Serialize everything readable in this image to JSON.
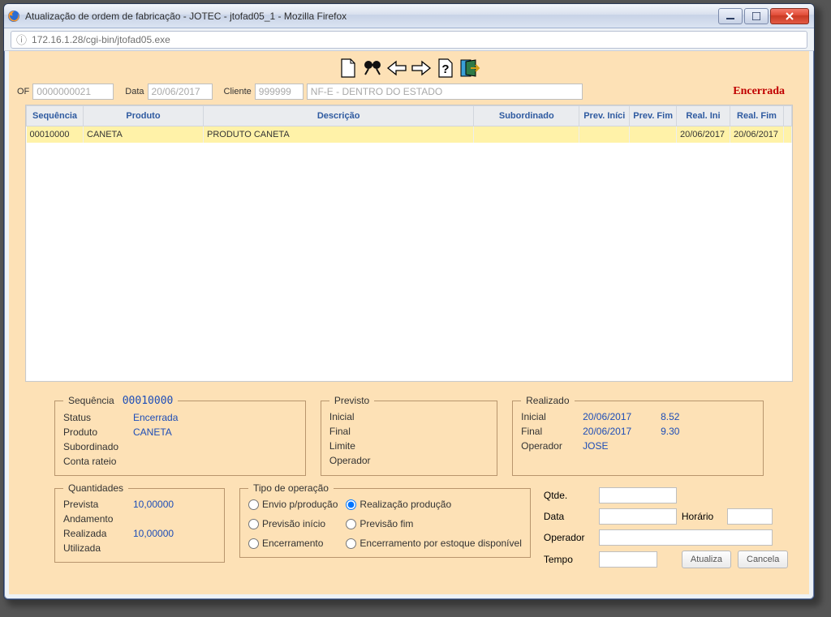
{
  "window": {
    "title": "Atualização de ordem de fabricação - JOTEC - jtofad05_1 - Mozilla Firefox",
    "url": "172.16.1.28/cgi-bin/jtofad05.exe"
  },
  "form": {
    "of_label": "OF",
    "of_value": "0000000021",
    "data_label": "Data",
    "data_value": "20/06/2017",
    "cliente_label": "Cliente",
    "cliente_value": "999999",
    "cliente_nome": "NF-E - DENTRO DO ESTADO",
    "status": "Encerrada"
  },
  "columns": {
    "c0": "Sequência",
    "c1": "Produto",
    "c2": "Descrição",
    "c3": "Subordinado",
    "c4": "Prev. Iníci",
    "c5": "Prev. Fim",
    "c6": "Real. Ini",
    "c7": "Real. Fim"
  },
  "rows": [
    {
      "seq": "00010000",
      "produto": "CANETA",
      "descricao": "PRODUTO CANETA",
      "subordinado": "",
      "prev_ini": "",
      "prev_fim": "",
      "real_ini": "20/06/2017",
      "real_fim": "20/06/2017"
    }
  ],
  "sequencia": {
    "legend": "Sequência",
    "code": "00010000",
    "status_k": "Status",
    "status_v": "Encerrada",
    "produto_k": "Produto",
    "produto_v": "CANETA",
    "subordinado_k": "Subordinado",
    "subordinado_v": "",
    "conta_k": "Conta rateio",
    "conta_v": ""
  },
  "previsto": {
    "legend": "Previsto",
    "inicial_k": "Inicial",
    "inicial_v": "",
    "final_k": "Final",
    "final_v": "",
    "limite_k": "Limite",
    "limite_v": "",
    "operador_k": "Operador",
    "operador_v": ""
  },
  "realizado": {
    "legend": "Realizado",
    "inicial_k": "Inicial",
    "inicial_d": "20/06/2017",
    "inicial_h": "8.52",
    "final_k": "Final",
    "final_d": "20/06/2017",
    "final_h": "9.30",
    "operador_k": "Operador",
    "operador_v": "JOSE"
  },
  "quantidades": {
    "legend": "Quantidades",
    "prevista_k": "Prevista",
    "prevista_v": "10,00000",
    "andamento_k": "Andamento",
    "andamento_v": "",
    "realizada_k": "Realizada",
    "realizada_v": "10,00000",
    "utilizada_k": "Utilizada",
    "utilizada_v": ""
  },
  "tipo": {
    "legend": "Tipo de operação",
    "r0": "Envio p/produção",
    "r1": "Realização produção",
    "r2": "Previsão início",
    "r3": "Previsão fim",
    "r4": "Encerramento",
    "r5": "Encerramento por estoque disponível"
  },
  "right": {
    "qtde_k": "Qtde.",
    "qtde_v": "",
    "data_k": "Data",
    "data_v": "",
    "horario_k": "Horário",
    "horario_v": "",
    "operador_k": "Operador",
    "operador_v": "",
    "tempo_k": "Tempo",
    "tempo_v": "",
    "atualiza": "Atualiza",
    "cancela": "Cancela"
  }
}
